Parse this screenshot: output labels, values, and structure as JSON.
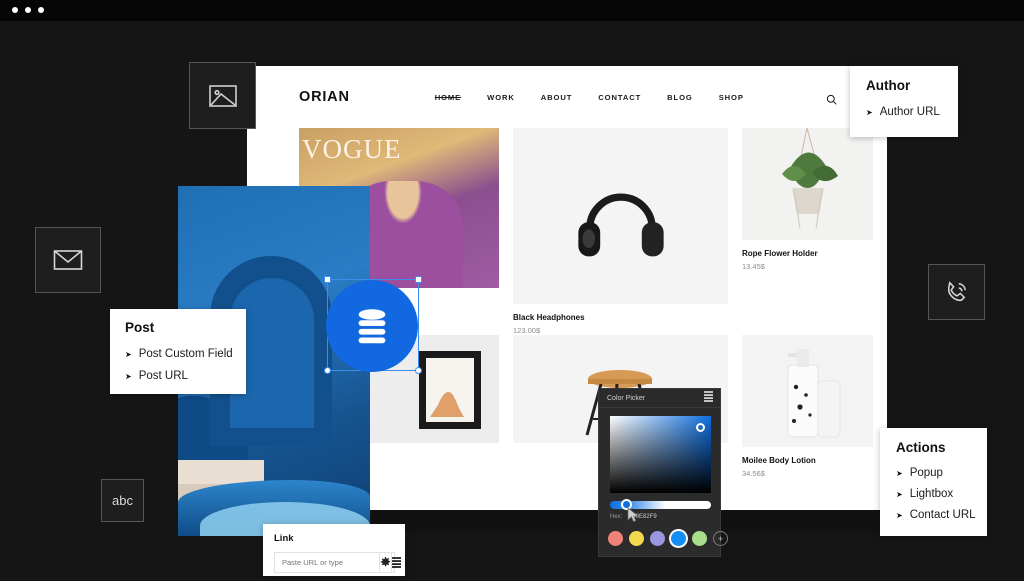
{
  "window": {
    "dots": [
      "dot-1",
      "dot-2",
      "dot-3"
    ]
  },
  "site": {
    "brand": "ORIAN",
    "nav": [
      {
        "label": "HOME",
        "active": true
      },
      {
        "label": "WORK",
        "active": false
      },
      {
        "label": "ABOUT",
        "active": false
      },
      {
        "label": "CONTACT",
        "active": false
      },
      {
        "label": "BLOG",
        "active": false
      },
      {
        "label": "SHOP",
        "active": false
      }
    ],
    "search_icon": "search-icon",
    "products": [
      {
        "title": "Black Headphones",
        "price": "123.00$"
      },
      {
        "title": "Rope Flower Holder",
        "price": "13.45$"
      },
      {
        "title": "Moilee Body Lotion",
        "price": "34.56$"
      }
    ]
  },
  "cards": {
    "author": {
      "title": "Author",
      "items": [
        {
          "label": "Author URL"
        }
      ]
    },
    "post": {
      "title": "Post",
      "items": [
        {
          "label": "Post Custom Field"
        },
        {
          "label": "Post URL"
        }
      ]
    },
    "actions": {
      "title": "Actions",
      "items": [
        {
          "label": "Popup"
        },
        {
          "label": "Lightbox"
        },
        {
          "label": "Contact URL"
        }
      ]
    },
    "link": {
      "title": "Link",
      "placeholder": "Paste URL or type",
      "value": "",
      "settings_icon": "gear-icon",
      "list_icon": "list-icon"
    }
  },
  "tools": [
    {
      "name": "image-icon",
      "label": ""
    },
    {
      "name": "mail-icon",
      "label": ""
    },
    {
      "name": "phone-icon",
      "label": ""
    },
    {
      "name": "text-icon",
      "label": "abc"
    }
  ],
  "selection": {
    "icon": "database-icon",
    "accent": "#1268e0"
  },
  "color_picker": {
    "title": "Color Picker",
    "menu_icon": "list-icon",
    "hex_label": "Hex:",
    "hex_value": "#0E82F9",
    "selected_color": "#0d6ee0",
    "swatches": [
      {
        "color": "#ef8278",
        "selected": false
      },
      {
        "color": "#f2d94e",
        "selected": false
      },
      {
        "color": "#9a96e0",
        "selected": false
      },
      {
        "color": "#108ef5",
        "selected": true
      },
      {
        "color": "#a8de8a",
        "selected": false
      }
    ],
    "add_label": "+"
  }
}
